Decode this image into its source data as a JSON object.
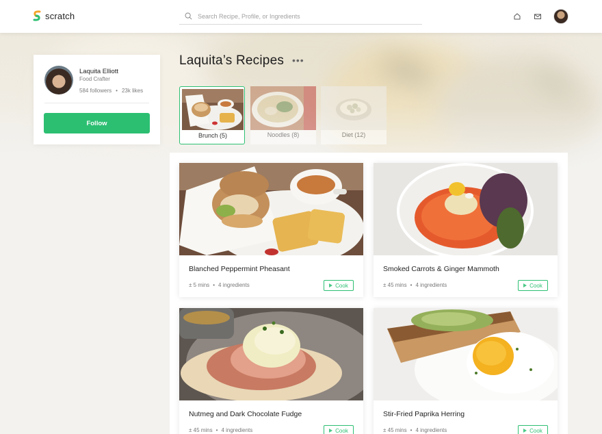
{
  "app": {
    "name": "scratch"
  },
  "search": {
    "placeholder": "Search Recipe, Profile, or Ingredients"
  },
  "profile": {
    "name": "Laquita Elliott",
    "role": "Food Crafter",
    "followers": "584 followers",
    "separator": "•",
    "likes": "23k likes",
    "follow_label": "Follow"
  },
  "page": {
    "title": "Laquita’s Recipes",
    "more": "•••"
  },
  "categories": [
    {
      "label": "Brunch (5)",
      "active": true
    },
    {
      "label": "Noodles (8)",
      "active": false
    },
    {
      "label": "Diet (12)",
      "active": false
    }
  ],
  "recipes": [
    {
      "name": "Blanched Peppermint Pheasant",
      "time": "± 5 mins",
      "sep": "•",
      "ingredients": "4 ingredients",
      "action": "Cook"
    },
    {
      "name": "Smoked Carrots & Ginger Mammoth",
      "time": "± 45 mins",
      "sep": "•",
      "ingredients": "4 ingredients",
      "action": "Cook"
    },
    {
      "name": "Nutmeg and Dark Chocolate Fudge",
      "time": "± 45 mins",
      "sep": "•",
      "ingredients": "4 ingredients",
      "action": "Cook"
    },
    {
      "name": "Stir-Fried Paprika Herring",
      "time": "± 45 mins",
      "sep": "•",
      "ingredients": "4 ingredients",
      "action": "Cook"
    }
  ],
  "icons": {
    "logo": "scratch-logo-icon",
    "search": "search-icon",
    "home": "home-icon",
    "mail": "mail-icon",
    "play": "play-icon"
  },
  "colors": {
    "accent": "#2cbf72",
    "text": "#1f1f1f",
    "muted": "#777777"
  }
}
